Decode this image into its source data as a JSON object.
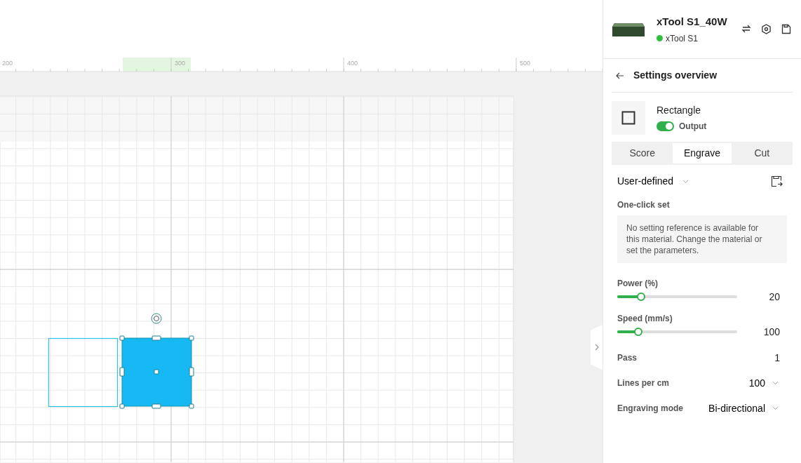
{
  "ruler": {
    "labels": [
      "200",
      "300",
      "400",
      "500"
    ]
  },
  "canvas": {
    "shapes": [
      {
        "kind": "rectangle",
        "selected": false
      },
      {
        "kind": "rectangle",
        "selected": true
      }
    ]
  },
  "device": {
    "name": "xTool S1_40W",
    "status": "xTool S1",
    "online": true
  },
  "panel": {
    "title": "Settings overview",
    "object": {
      "name": "Rectangle",
      "output_label": "Output",
      "output_on": true
    },
    "tabs": [
      {
        "label": "Score",
        "selected": false
      },
      {
        "label": "Engrave",
        "selected": true
      },
      {
        "label": "Cut",
        "selected": false
      }
    ],
    "preset": "User-defined",
    "one_click_label": "One-click set",
    "notice": "No setting reference is available for this material. Change the material or set the parameters.",
    "sliders": [
      {
        "label": "Power (%)",
        "level": 0.2,
        "reading": "20"
      },
      {
        "label": "Speed (mm/s)",
        "level": 0.175,
        "reading": "100"
      }
    ],
    "settings": [
      {
        "label": "Pass",
        "value": "1",
        "kind": "number"
      },
      {
        "label": "Lines per cm",
        "value": "100",
        "kind": "dropdown"
      },
      {
        "label": "Engraving mode",
        "value": "Bi-directional",
        "kind": "dropdown"
      }
    ]
  }
}
